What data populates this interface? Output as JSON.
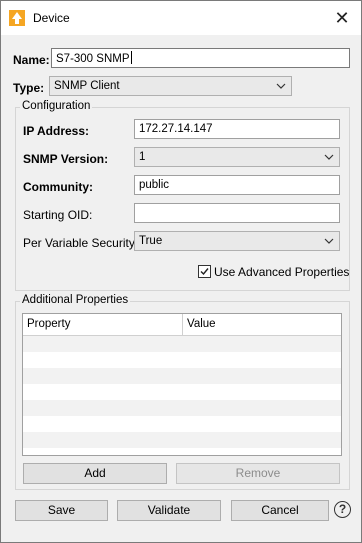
{
  "window": {
    "title": "Device",
    "close_icon": "close-icon",
    "app_icon": "device-app-icon"
  },
  "form": {
    "name_label": "Name:",
    "name_value": "S7-300 SNMP",
    "type_label": "Type:",
    "type_value": "SNMP Client"
  },
  "configuration": {
    "group_title": "Configuration",
    "ip_label": "IP Address:",
    "ip_value": "172.27.14.147",
    "snmp_version_label": "SNMP Version:",
    "snmp_version_value": "1",
    "community_label": "Community:",
    "community_value": "public",
    "starting_oid_label": "Starting OID:",
    "starting_oid_value": "",
    "per_var_security_label": "Per Variable Security:",
    "per_var_security_value": "True",
    "advanced_props_label": "Use Advanced Properties",
    "advanced_props_checked": true
  },
  "additional_properties": {
    "group_title": "Additional Properties",
    "columns": [
      "Property",
      "Value"
    ],
    "rows": [],
    "add_label": "Add",
    "remove_label": "Remove"
  },
  "footer": {
    "save_label": "Save",
    "validate_label": "Validate",
    "cancel_label": "Cancel",
    "help_label": "?"
  }
}
